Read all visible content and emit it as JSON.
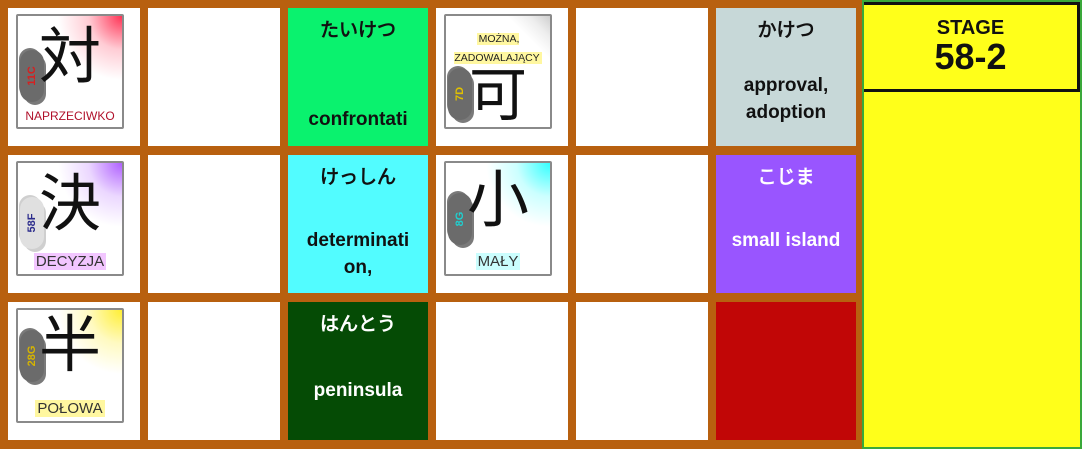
{
  "stage": {
    "label": "STAGE",
    "number": "58-2"
  },
  "colors": {
    "board_bg": "#b8600f",
    "panel_bg": "#ffff1a",
    "panel_border": "#3aa83a",
    "word_confrontation": "#0af26e",
    "word_determination": "#52fcff",
    "word_peninsula": "#054b05",
    "word_approval": "#c7d8d8",
    "word_small_island": "#9955ff",
    "red_tile": "#c10606"
  },
  "kanji": [
    {
      "glyph": "対",
      "meaning": "NAPRZECIWKO",
      "code": "11C",
      "code_color": "#d62020",
      "accent": "#ff3355"
    },
    {
      "glyph": "決",
      "meaning": "DECYZJA",
      "code": "58F",
      "code_color": "#2c2c8c",
      "accent": "#b060ff"
    },
    {
      "glyph": "半",
      "meaning": "POŁOWA",
      "code": "28G",
      "code_color": "#d6b400",
      "accent": "#ffee33"
    },
    {
      "glyph": "可",
      "meaning": "MOŻNA, ZADOWALAJĄCY",
      "code": "7D",
      "code_color": "#e0c000",
      "accent": "#cccccc"
    },
    {
      "glyph": "小",
      "meaning": "MAŁY",
      "code": "8G",
      "code_color": "#1fd0d0",
      "accent": "#33ffff"
    }
  ],
  "words": [
    {
      "kana": "たいけつ",
      "meaning": "confrontati"
    },
    {
      "kana": "けっしん",
      "meaning": "determinati\non,"
    },
    {
      "kana": "はんとう",
      "meaning": "peninsula"
    },
    {
      "kana": "かけつ",
      "meaning": "approval,\nadoption"
    },
    {
      "kana": "こじま",
      "meaning": "small island"
    }
  ]
}
